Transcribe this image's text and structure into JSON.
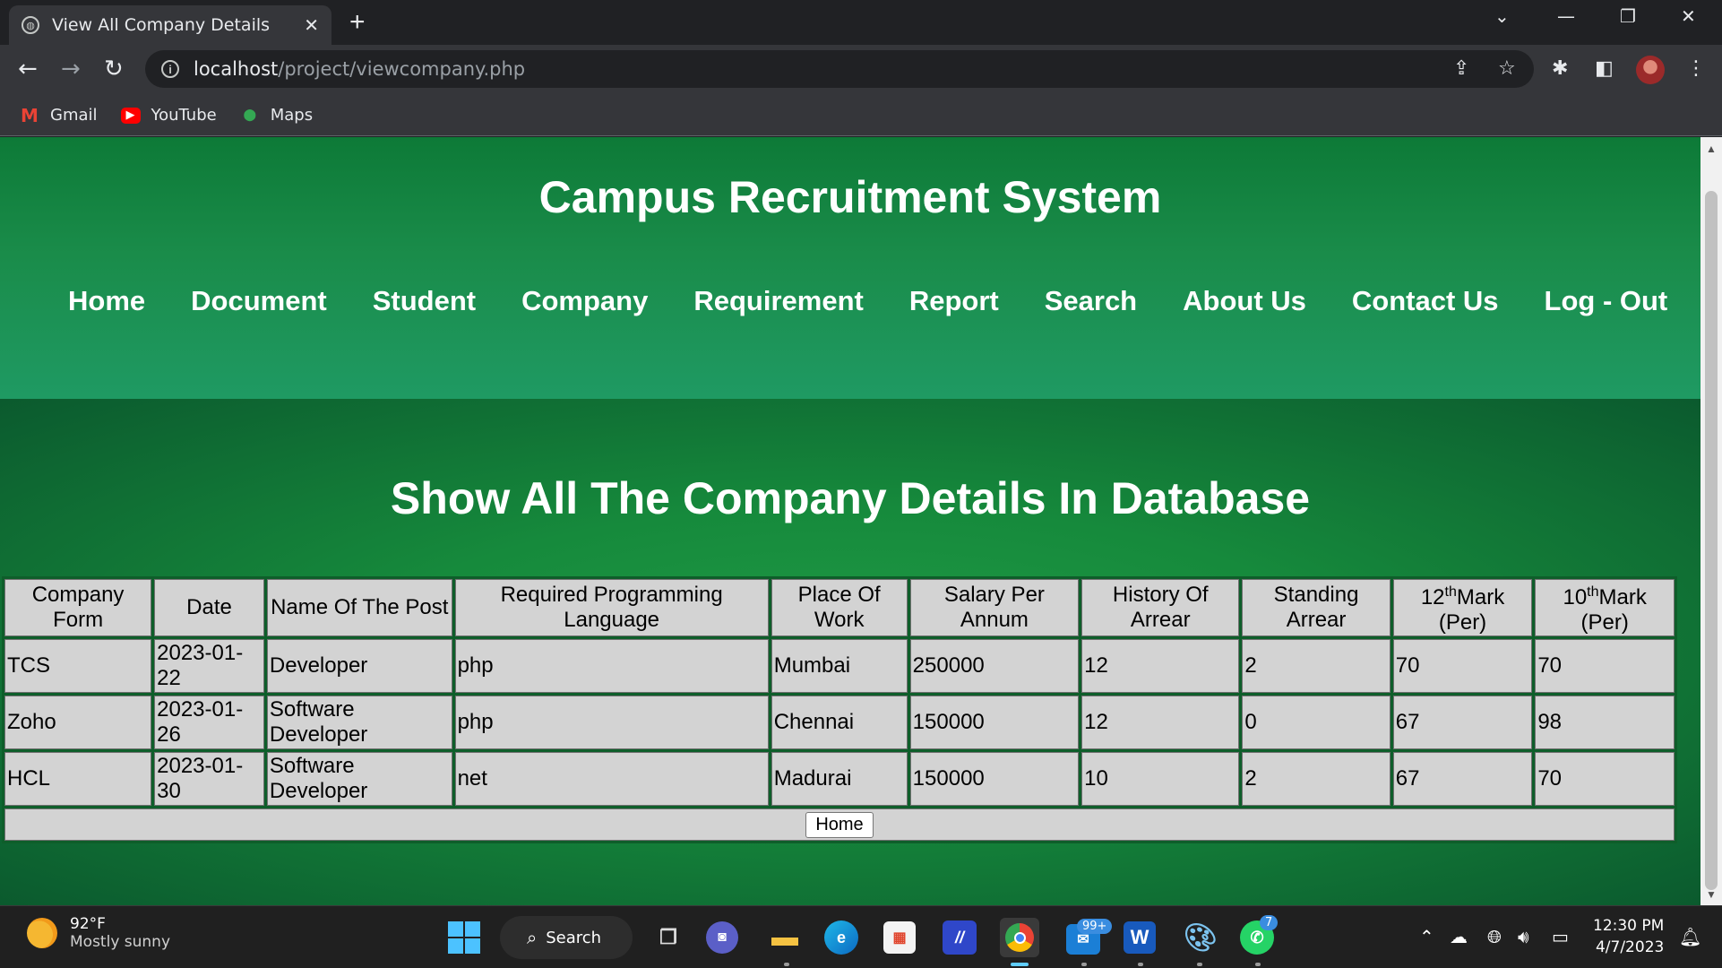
{
  "browser": {
    "tab_title": "View All Company Details",
    "url_host": "localhost",
    "url_path": "/project/viewcompany.php",
    "bookmarks": [
      "Gmail",
      "YouTube",
      "Maps"
    ]
  },
  "site": {
    "title": "Campus Recruitment System",
    "menu": [
      "Home",
      "Document",
      "Student",
      "Company",
      "Requirement",
      "Report",
      "Search",
      "About Us",
      "Contact Us",
      "Log - Out"
    ]
  },
  "page": {
    "heading": "Show All The Company Details In Database",
    "home_button": "Home"
  },
  "table": {
    "headers": [
      {
        "text": "Company Form"
      },
      {
        "text": "Date"
      },
      {
        "text": "Name Of The Post"
      },
      {
        "text": "Required Programming Language"
      },
      {
        "text": "Place Of Work"
      },
      {
        "text": "Salary Per Annum"
      },
      {
        "text": "History Of Arrear"
      },
      {
        "text": "Standing Arrear"
      },
      {
        "sup_pre": "12",
        "sup": "th",
        "sup_post": "Mark (Per)"
      },
      {
        "sup_pre": "10",
        "sup": "th",
        "sup_post": "Mark (Per)"
      }
    ],
    "rows": [
      [
        "TCS",
        "2023-01-22",
        "Developer",
        "php",
        "Mumbai",
        "250000",
        "12",
        "2",
        "70",
        "70"
      ],
      [
        "Zoho",
        "2023-01-26",
        "Software Developer",
        "php",
        "Chennai",
        "150000",
        "12",
        "0",
        "67",
        "98"
      ],
      [
        "HCL",
        "2023-01-30",
        "Software Developer",
        "net",
        "Madurai",
        "150000",
        "10",
        "2",
        "67",
        "70"
      ]
    ]
  },
  "taskbar": {
    "temperature": "92°F",
    "weather": "Mostly sunny",
    "search_label": "Search",
    "mail_badge": "99+",
    "whatsapp_badge": "7",
    "time": "12:30 PM",
    "date": "4/7/2023"
  }
}
